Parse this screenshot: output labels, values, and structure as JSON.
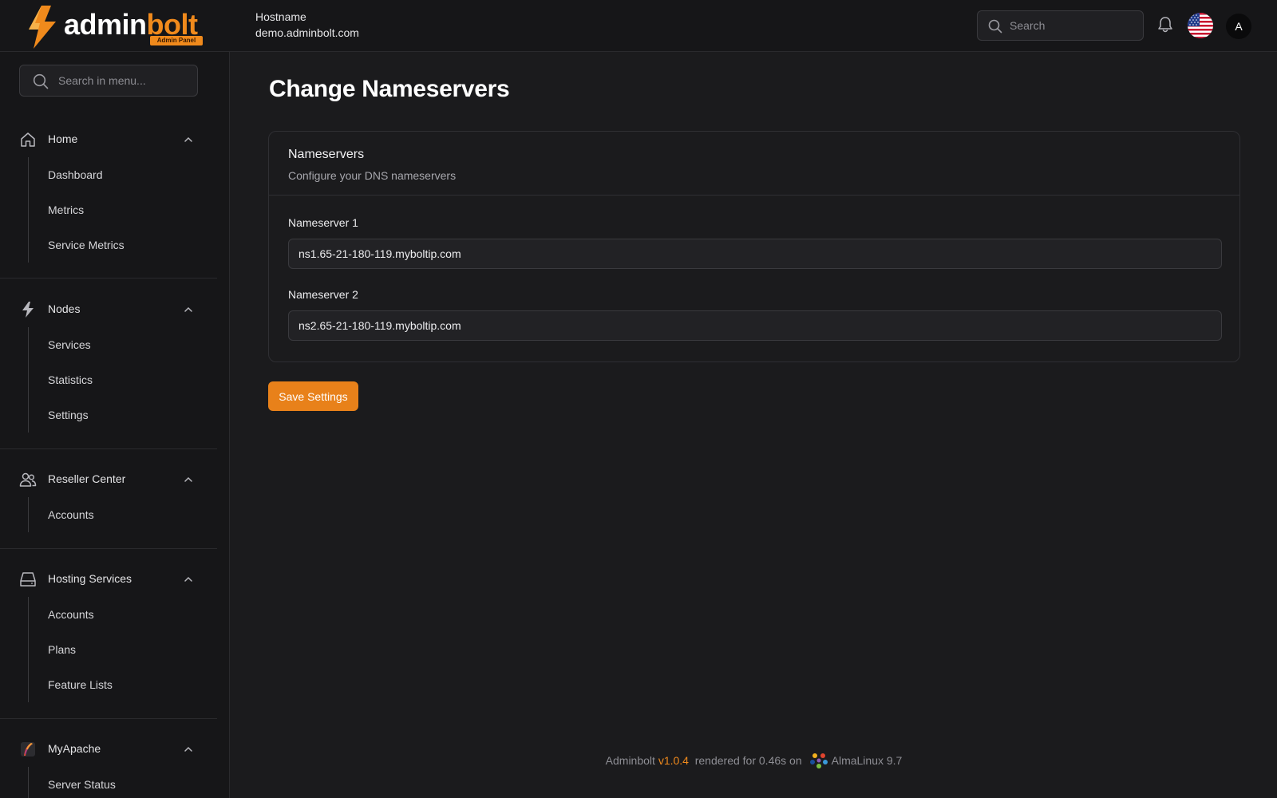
{
  "header": {
    "logo": {
      "word_primary": "admin",
      "word_accent": "bolt",
      "tagline": "Admin Panel"
    },
    "hostname_label": "Hostname",
    "hostname_value": "demo.adminbolt.com",
    "search_placeholder": "Search",
    "avatar_initial": "A",
    "icons": [
      "search-icon",
      "bell-icon",
      "us-flag-icon"
    ]
  },
  "sidebar": {
    "search_placeholder": "Search in menu...",
    "groups": [
      {
        "label": "Home",
        "icon": "home-icon",
        "items": [
          "Dashboard",
          "Metrics",
          "Service Metrics"
        ]
      },
      {
        "label": "Nodes",
        "icon": "bolt-icon",
        "items": [
          "Services",
          "Statistics",
          "Settings"
        ]
      },
      {
        "label": "Reseller Center",
        "icon": "users-icon",
        "items": [
          "Accounts"
        ]
      },
      {
        "label": "Hosting Services",
        "icon": "server-icon",
        "items": [
          "Accounts",
          "Plans",
          "Feature Lists"
        ]
      },
      {
        "label": "MyApache",
        "icon": "apache-feather-icon",
        "items": [
          "Server Status"
        ]
      }
    ]
  },
  "main": {
    "title": "Change Nameservers",
    "card": {
      "title": "Nameservers",
      "description": "Configure your DNS nameservers",
      "fields": [
        {
          "label": "Nameserver 1",
          "value": "ns1.65-21-180-119.myboltip.com"
        },
        {
          "label": "Nameserver 2",
          "value": "ns2.65-21-180-119.myboltip.com"
        }
      ]
    },
    "save_button": "Save Settings"
  },
  "footer": {
    "product": "Adminbolt",
    "version": "v1.0.4",
    "rendered": "rendered for 0.46s on",
    "os": "AlmaLinux 9.7"
  },
  "colors": {
    "accent": "#e8811a",
    "background": "#1b1b1d",
    "sidebar": "#161618"
  }
}
